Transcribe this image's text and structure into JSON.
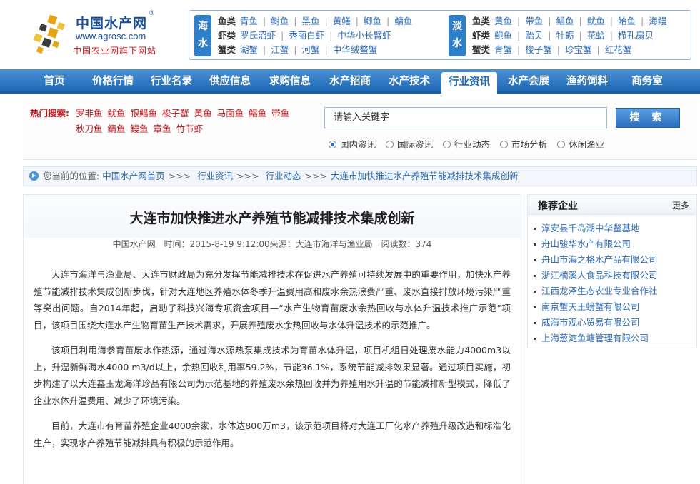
{
  "header": {
    "logo_title": "中国水产网",
    "logo_reg": "®",
    "logo_url": "www.agrosc.com",
    "logo_sub": "中国农业网旗下网站",
    "sea_label": "海水",
    "fresh_label": "淡水",
    "sea_rows": [
      {
        "label": "鱼类",
        "items": [
          "青鱼",
          "鲥鱼",
          "黑鱼",
          "黄鳝",
          "鲫鱼",
          "鳙鱼"
        ]
      },
      {
        "label": "虾类",
        "items": [
          "罗氏沼虾",
          "秀丽白虾",
          "中华小长臂虾"
        ]
      },
      {
        "label": "蟹类",
        "items": [
          "湖蟹",
          "江蟹",
          "河蟹",
          "中华绒螯蟹"
        ]
      }
    ],
    "fresh_rows": [
      {
        "label": "鱼类",
        "items": [
          "黄鱼",
          "带鱼",
          "鲳鱼",
          "鱿鱼",
          "鲐鱼",
          "海鳗"
        ]
      },
      {
        "label": "虾类",
        "items": [
          "鲍鱼",
          "贻贝",
          "牡蛎",
          "花蛤",
          "栉孔扇贝"
        ]
      },
      {
        "label": "蟹类",
        "items": [
          "青蟹",
          "梭子蟹",
          "珍宝蟹",
          "红花蟹"
        ]
      }
    ]
  },
  "nav": {
    "items": [
      "首页",
      "价格行情",
      "行业名录",
      "供应信息",
      "求购信息",
      "水产招商",
      "水产技术",
      "行业资讯",
      "水产会展",
      "渔药饲料",
      "商务室"
    ],
    "active_index": 7
  },
  "search": {
    "hot_label": "热门搜索:",
    "hot_row1": [
      "罗非鱼",
      "鱿鱼",
      "银鲳鱼",
      "梭子蟹",
      "黄鱼",
      "马面鱼",
      "鲳鱼",
      "带鱼"
    ],
    "hot_row2": [
      "秋刀鱼",
      "鲭鱼",
      "鳗鱼",
      "章鱼",
      "竹节虾"
    ],
    "input_value": "请输入关键字",
    "button_label": "搜 索",
    "radios": [
      {
        "label": "国内资讯",
        "checked": true
      },
      {
        "label": "国际资讯",
        "checked": false
      },
      {
        "label": "行业动态",
        "checked": false
      },
      {
        "label": "市场分析",
        "checked": false
      },
      {
        "label": "休闲渔业",
        "checked": false
      }
    ]
  },
  "breadcrumb": {
    "prefix": "您当前的位置:",
    "links": [
      "中国水产网首页",
      "行业资讯",
      "行业动态"
    ],
    "sep": ">>>",
    "current": "大连市加快推进水产养殖节能减排技术集成创新"
  },
  "article": {
    "title": "大连市加快推进水产养殖节能减排技术集成创新",
    "meta_site": "中国水产网",
    "meta_time": "时间：2015-8-19 9:12:00来源：大连市海洋与渔业局",
    "meta_reads": "阅读数：374",
    "paragraphs": [
      "大连市海洋与渔业局、大连市财政局为充分发挥节能减排技术在促进水产养殖可持续发展中的重要作用，加快水产养殖节能减排技术集成创新步伐，针对大连地区养殖水体冬季升温费用高和废水余热浪费严重、废水直接排放环境污染严重等突出问题。自2014年起，启动了科技兴海专项资金项目—“水产生物育苗废水余热回收与水体升温技术推广示范”项目，该项目围绕大连水产生物育苗生产技术需求，开展养殖废水余热回收与水体升温技术的示范推广。",
      "该项目利用海参育苗废水作热源，通过海水源热泵集成技术为育苗水体升温，项目机组日处理废水能力4000m3以上，升温新鲜海水4000 m3/d以上，余热回收利用率59.2%，节能36.1%，系统节能减排效果显著。通过项目实施，初步构建了以大连鑫玉龙海洋珍品有限公司为示范基地的养殖废水余热回收并为养殖用水升温的节能减排新型模式，降低了企业水体升温费用、减少了环境污染。",
      "目前，大连市有育苗养殖企业4000余家，水体达800万m3，该示范项目将对大连工厂化水产养殖升级改造和标准化生产，实现水产养殖节能减排具有积极的示范作用。"
    ]
  },
  "sidebar": {
    "title": "推荐企业",
    "more": "更多",
    "items": [
      "淳安县千岛湖中华鳖基地",
      "舟山骏华水产有限公司",
      "舟山市海之格水产品有限公司",
      "浙江楠溪人食品科技有限公司",
      "江西龙泽生态农业专业合作社",
      "南京蟹天王螃蟹有限公司",
      "威海市观心贸易有限公司",
      "上海葱淀鱼塘管理有限公司"
    ]
  },
  "colors": {
    "brand_blue": "#1a4f9a",
    "nav_blue": "#1f68b4",
    "link_blue": "#2e6bb0",
    "hot_red": "#c0171b"
  }
}
